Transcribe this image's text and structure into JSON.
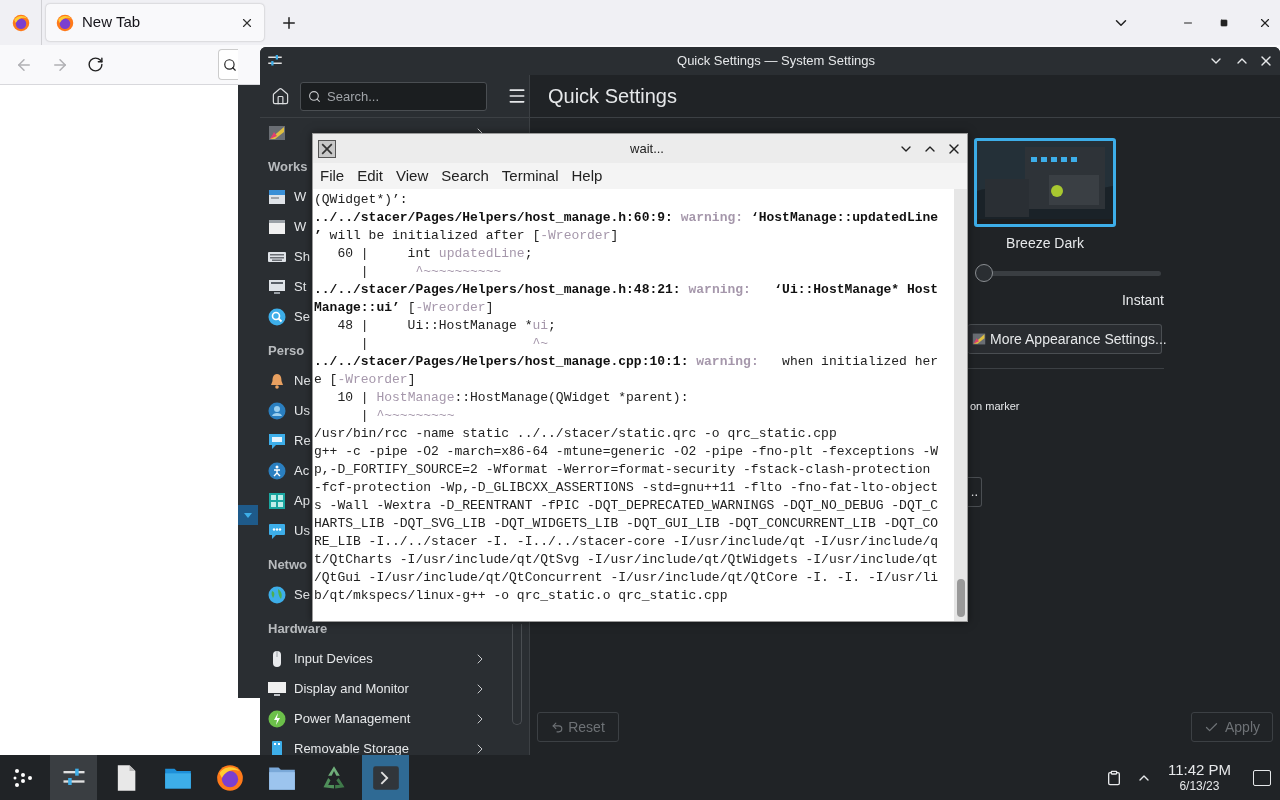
{
  "browser": {
    "tabs": [
      {
        "label": "New Tab",
        "selected": true
      }
    ],
    "back": {
      "disabled": true
    },
    "forward": {
      "disabled": true
    }
  },
  "settings_window": {
    "title": "Quick Settings — System Settings",
    "search": {
      "placeholder": "Search..."
    },
    "page_title": "Quick Settings",
    "sidebar": {
      "top_item": {
        "expandable": true
      },
      "sections": [
        {
          "title": "Works",
          "items": [
            {
              "label": "W"
            },
            {
              "label": "W"
            },
            {
              "label": "Sh"
            },
            {
              "label": "St"
            },
            {
              "label": "Se"
            }
          ]
        },
        {
          "title": "Perso",
          "items": [
            {
              "label": "Ne"
            },
            {
              "label": "Us"
            },
            {
              "label": "Re"
            },
            {
              "label": "Ac"
            },
            {
              "label": "Ap"
            },
            {
              "label": "Us"
            }
          ]
        },
        {
          "title": "Netwo",
          "items": [
            {
              "label": "Se"
            }
          ]
        },
        {
          "title": "Hardware",
          "items": [
            {
              "label": "Input Devices",
              "expandable": true
            },
            {
              "label": "Display and Monitor",
              "expandable": true
            },
            {
              "label": "Power Management",
              "expandable": true
            },
            {
              "label": "Removable Storage",
              "expandable": true
            }
          ]
        }
      ]
    },
    "theme": {
      "name": "Breeze Dark",
      "selected": true
    },
    "animation_slider": {
      "level": 0,
      "label": "Instant"
    },
    "more_button": "More Appearance Settings...",
    "partial_text": "on marker",
    "partial_button": "..",
    "footer": {
      "reset": {
        "label": "Reset",
        "disabled": true
      },
      "apply": {
        "label": "Apply",
        "disabled": true
      }
    }
  },
  "terminal": {
    "title": "wait...",
    "menu": [
      "File",
      "Edit",
      "View",
      "Search",
      "Terminal",
      "Help"
    ],
    "lines": [
      [
        {
          "kind": "plain",
          "text": "(QWidget*)’:"
        }
      ],
      [
        {
          "kind": "bold",
          "text": "../../stacer/Pages/Helpers/host_manage.h:60:9:"
        },
        {
          "kind": "warn",
          "text": " warning:"
        },
        {
          "kind": "bold",
          "text": " ‘HostManage::updatedLine"
        }
      ],
      [
        {
          "kind": "bold",
          "text": "’"
        },
        {
          "kind": "plain",
          "text": " will be initialized after ["
        },
        {
          "kind": "hl",
          "text": "-Wreorder"
        },
        {
          "kind": "plain",
          "text": "]"
        }
      ],
      [
        {
          "kind": "plain",
          "text": "   60 |     int "
        },
        {
          "kind": "hl",
          "text": "updatedLine"
        },
        {
          "kind": "plain",
          "text": ";"
        }
      ],
      [
        {
          "kind": "plain",
          "text": "      |      "
        },
        {
          "kind": "hl",
          "text": "^~~~~~~~~~~"
        }
      ],
      [
        {
          "kind": "bold",
          "text": "../../stacer/Pages/Helpers/host_manage.h:48:21:"
        },
        {
          "kind": "warn",
          "text": " warning:"
        },
        {
          "kind": "bold",
          "text": "   ‘Ui::HostManage* Host"
        }
      ],
      [
        {
          "kind": "bold",
          "text": "Manage::ui’"
        },
        {
          "kind": "plain",
          "text": " ["
        },
        {
          "kind": "hl",
          "text": "-Wreorder"
        },
        {
          "kind": "plain",
          "text": "]"
        }
      ],
      [
        {
          "kind": "plain",
          "text": "   48 |     Ui::HostManage *"
        },
        {
          "kind": "hl",
          "text": "ui"
        },
        {
          "kind": "plain",
          "text": ";"
        }
      ],
      [
        {
          "kind": "plain",
          "text": "      |                     "
        },
        {
          "kind": "hl",
          "text": "^~"
        }
      ],
      [
        {
          "kind": "bold",
          "text": "../../stacer/Pages/Helpers/host_manage.cpp:10:1:"
        },
        {
          "kind": "warn",
          "text": " warning:"
        },
        {
          "kind": "plain",
          "text": "   when initialized her"
        }
      ],
      [
        {
          "kind": "plain",
          "text": "e ["
        },
        {
          "kind": "hl",
          "text": "-Wreorder"
        },
        {
          "kind": "plain",
          "text": "]"
        }
      ],
      [
        {
          "kind": "plain",
          "text": "   10 | "
        },
        {
          "kind": "hl",
          "text": "HostManage"
        },
        {
          "kind": "plain",
          "text": "::HostManage(QWidget *parent):"
        }
      ],
      [
        {
          "kind": "plain",
          "text": "      | "
        },
        {
          "kind": "hl",
          "text": "^~~~~~~~~~"
        }
      ],
      [
        {
          "kind": "plain",
          "text": "/usr/bin/rcc -name static ../../stacer/static.qrc -o qrc_static.cpp"
        }
      ],
      [
        {
          "kind": "plain",
          "text": "g++ -c -pipe -O2 -march=x86-64 -mtune=generic -O2 -pipe -fno-plt -fexceptions -W"
        }
      ],
      [
        {
          "kind": "plain",
          "text": "p,-D_FORTIFY_SOURCE=2 -Wformat -Werror=format-security -fstack-clash-protection"
        }
      ],
      [
        {
          "kind": "plain",
          "text": "-fcf-protection -Wp,-D_GLIBCXX_ASSERTIONS -std=gnu++11 -flto -fno-fat-lto-object"
        }
      ],
      [
        {
          "kind": "plain",
          "text": "s -Wall -Wextra -D_REENTRANT -fPIC -DQT_DEPRECATED_WARNINGS -DQT_NO_DEBUG -DQT_C"
        }
      ],
      [
        {
          "kind": "plain",
          "text": "HARTS_LIB -DQT_SVG_LIB -DQT_WIDGETS_LIB -DQT_GUI_LIB -DQT_CONCURRENT_LIB -DQT_CO"
        }
      ],
      [
        {
          "kind": "plain",
          "text": "RE_LIB -I../../stacer -I. -I../../stacer-core -I/usr/include/qt -I/usr/include/q"
        }
      ],
      [
        {
          "kind": "plain",
          "text": "t/QtCharts -I/usr/include/qt/QtSvg -I/usr/include/qt/QtWidgets -I/usr/include/qt"
        }
      ],
      [
        {
          "kind": "plain",
          "text": "/QtGui -I/usr/include/qt/QtConcurrent -I/usr/include/qt/QtCore -I. -I. -I/usr/li"
        }
      ],
      [
        {
          "kind": "plain",
          "text": "b/qt/mkspecs/linux-g++ -o qrc_static.o qrc_static.cpp"
        }
      ]
    ]
  },
  "taskbar": {
    "tasks": [
      {
        "open": true,
        "selected": false
      },
      {
        "open": false,
        "selected": false
      },
      {
        "open": false,
        "selected": false
      },
      {
        "open": false,
        "selected": false
      },
      {
        "open": false,
        "selected": false
      },
      {
        "open": false,
        "selected": false
      },
      {
        "open": true,
        "selected": true
      }
    ],
    "clock": {
      "time": "11:42 PM",
      "date": "6/13/23"
    }
  }
}
